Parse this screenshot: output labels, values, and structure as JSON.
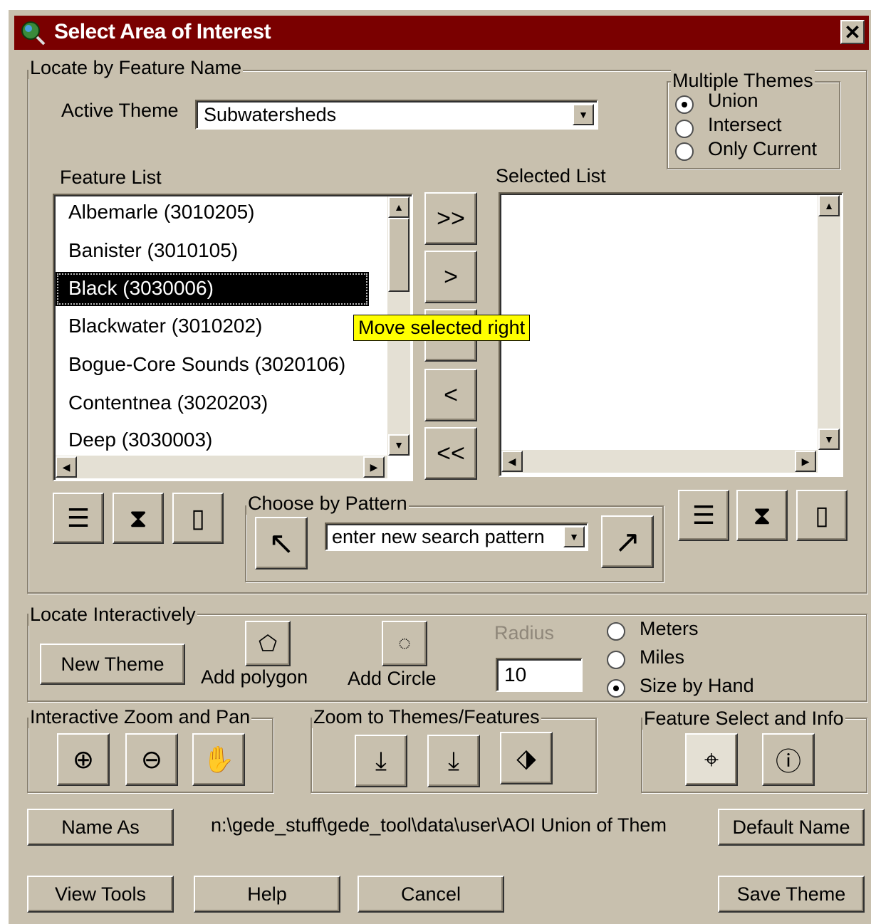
{
  "window": {
    "title": "Select Area of Interest",
    "close_label": "✕"
  },
  "locate_by_name": {
    "group_title": "Locate by Feature Name",
    "active_theme_label": "Active Theme",
    "active_theme_value": "Subwatersheds",
    "multiple_themes": {
      "title": "Multiple Themes",
      "options": [
        "Union",
        "Intersect",
        "Only Current"
      ],
      "selected": "Union"
    },
    "feature_list_label": "Feature List",
    "feature_list": [
      "Albemarle (3010205)",
      "Banister (3010105)",
      "Black (3030006)",
      "Blackwater (3010202)",
      "Bogue-Core Sounds (3020106)",
      "Contentnea (3020203)",
      "Deep (3030003)"
    ],
    "selected_feature": "Black (3030006)",
    "selected_list_label": "Selected List",
    "transfer_buttons": {
      "all_right": ">>",
      "right": ">",
      "left": "<",
      "all_left": "<<"
    },
    "tooltip": "Move selected right",
    "pattern": {
      "title": "Choose by Pattern",
      "placeholder": "enter new search pattern"
    }
  },
  "locate_interactive": {
    "group_title": "Locate Interactively",
    "new_theme": "New Theme",
    "add_polygon": "Add polygon",
    "add_circle": "Add Circle",
    "radius_label": "Radius",
    "radius_value": "10",
    "units": [
      "Meters",
      "Miles",
      "Size by Hand"
    ],
    "selected_unit": "Size by Hand"
  },
  "zoom_pan": {
    "group_title": "Interactive Zoom and Pan"
  },
  "zoom_themes": {
    "group_title": "Zoom to Themes/Features"
  },
  "feature_select": {
    "group_title": "Feature Select and Info"
  },
  "naming": {
    "name_as": "Name As",
    "path": "n:\\gede_stuff\\gede_tool\\data\\user\\AOI Union of Them",
    "default_name": "Default Name"
  },
  "footer": {
    "view_tools": "View Tools",
    "help": "Help",
    "cancel": "Cancel",
    "save_theme": "Save Theme"
  }
}
